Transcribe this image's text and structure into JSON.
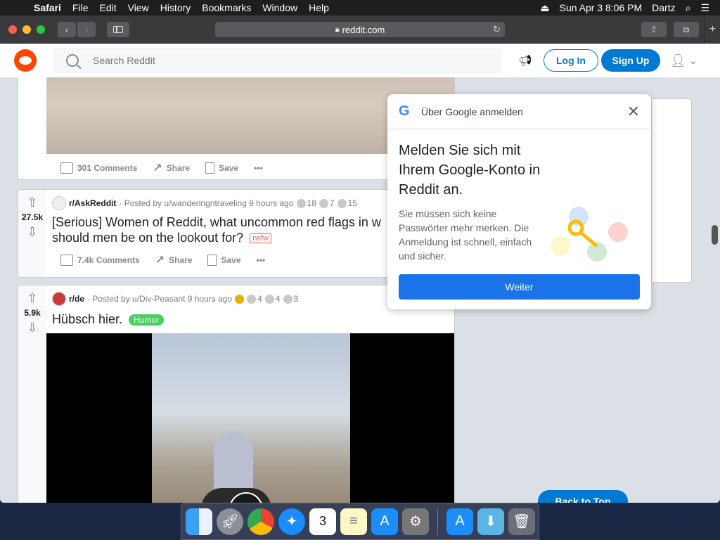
{
  "menubar": {
    "apple": "",
    "app": "Safari",
    "items": [
      "File",
      "Edit",
      "View",
      "History",
      "Bookmarks",
      "Window",
      "Help"
    ],
    "datetime": "Sun Apr 3  8:06 PM",
    "user": "Dartz"
  },
  "browser": {
    "url": "reddit.com"
  },
  "reddit": {
    "search_placeholder": "Search Reddit",
    "login": "Log In",
    "signup": "Sign Up"
  },
  "posts": [
    {
      "comments": "301 Comments",
      "share": "Share",
      "save": "Save"
    },
    {
      "subreddit": "r/AskReddit",
      "posted_by": "· Posted by u/wanderingntraveling 9 hours ago",
      "awards": [
        "18",
        "7",
        "15"
      ],
      "score": "27.5k",
      "title": "[Serious] Women of Reddit, what uncommon red flags in w",
      "title2": "should men be on the lookout for?",
      "tag": "nsfw",
      "comments": "7.4k Comments",
      "share": "Share",
      "save": "Save"
    },
    {
      "subreddit": "r/de",
      "posted_by": "· Posted by u/Div-Peasant 9 hours ago",
      "awards": [
        "4",
        "4",
        "3"
      ],
      "score": "5.9k",
      "title": "Hübsch hier.",
      "flair": "Humor"
    }
  ],
  "google_popup": {
    "header": "Über Google anmelden",
    "main": "Melden Sie sich mit Ihrem Google-Konto in Reddit an.",
    "sub": "Sie müssen sich keine Passwörter mehr merken. Die Anmeldung ist schnell, einfach und sicher.",
    "button": "Weiter"
  },
  "back_to_top": "Back to Top",
  "colors": {
    "reddit_orange": "#ff4500",
    "reddit_blue": "#0079d3",
    "google_blue": "#1a73e8"
  }
}
